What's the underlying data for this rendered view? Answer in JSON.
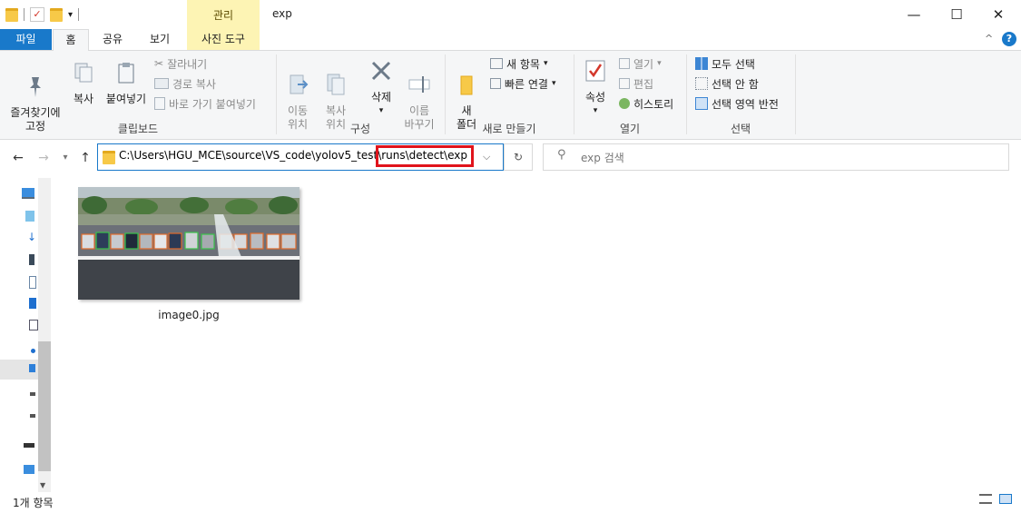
{
  "window": {
    "title": "exp",
    "context_tab": "관리",
    "minimize": "—",
    "maximize": "☐",
    "close": "✕"
  },
  "ribbon_tabs": {
    "file": "파일",
    "home": "홈",
    "share": "공유",
    "view": "보기",
    "picture_tools": "사진 도구"
  },
  "clipboard": {
    "pin": "즐겨찾기에\n고정",
    "copy": "복사",
    "paste": "붙여넣기",
    "cut": "잘라내기",
    "copy_path": "경로 복사",
    "paste_shortcut": "바로 가기 붙여넣기",
    "label": "클립보드"
  },
  "organize": {
    "move_to": "이동\n위치",
    "copy_to": "복사\n위치",
    "delete": "삭제",
    "rename": "이름\n바꾸기",
    "label": "구성"
  },
  "new": {
    "new_folder": "새\n폴더",
    "new_item": "새 항목",
    "easy_access": "빠른 연결",
    "label": "새로 만들기"
  },
  "open": {
    "properties": "속성",
    "open": "열기",
    "edit": "편집",
    "history": "히스토리",
    "label": "열기"
  },
  "select": {
    "select_all": "모두 선택",
    "select_none": "선택 안 함",
    "invert": "선택 영역 반전",
    "label": "선택"
  },
  "address": {
    "path_prefix": "C:\\Users\\HGU_MCE\\source\\VS_code\\yolov5_test",
    "path_highlight": "\\runs\\detect\\exp",
    "search_placeholder": "exp 검색"
  },
  "files": [
    {
      "name": "image0.jpg"
    }
  ],
  "status": {
    "count": "1개 항목"
  },
  "colors": {
    "accent": "#1979ca",
    "context_tab": "#fdf4b4",
    "highlight_box": "#e0141c"
  }
}
